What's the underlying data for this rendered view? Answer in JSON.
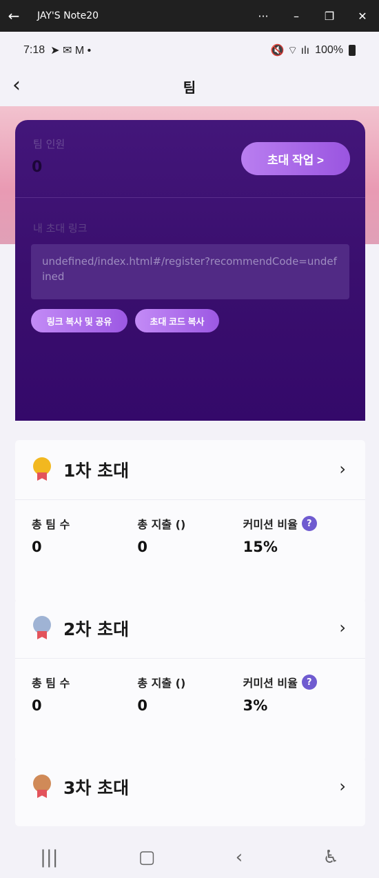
{
  "window": {
    "title": "JAY'S Note20",
    "back_icon": "←",
    "more_icon": "···",
    "minimize_icon": "–",
    "restore_icon": "❐",
    "close_icon": "✕"
  },
  "statusbar": {
    "time": "7:18",
    "notif_icons": "➤ ✉ M •",
    "right_icons": "🔇 ⌔ ılı",
    "battery": "100%"
  },
  "header": {
    "back": "‹",
    "title": "팀"
  },
  "team": {
    "count_label": "팀 인원",
    "count_value": "0",
    "invite_button": "초대 작업 >",
    "link_label": "내 초대 링크",
    "link_value": "undefined/index.html#/register?recommendCode=undefined",
    "copy_link_button": "링크 복사 및 공유",
    "copy_code_button": "초대 코드 복사",
    "faint_a": "",
    "faint_b": ""
  },
  "levels": [
    {
      "name": "1차 초대",
      "team_label": "총 팀 수",
      "team_value": "0",
      "spend_label": "총 지출 ()",
      "spend_value": "0",
      "rate_label": "커미션 비율",
      "rate_value": "15%"
    },
    {
      "name": "2차 초대",
      "team_label": "총 팀 수",
      "team_value": "0",
      "spend_label": "총 지출 ()",
      "spend_value": "0",
      "rate_label": "커미션 비율",
      "rate_value": "3%"
    },
    {
      "name": "3차 초대"
    }
  ],
  "help_glyph": "?",
  "chevron": "›",
  "colors": {
    "gold": "#f2b820",
    "silver": "#9fb3d4",
    "bronze": "#d08a58",
    "accent": "#9a55e0"
  }
}
